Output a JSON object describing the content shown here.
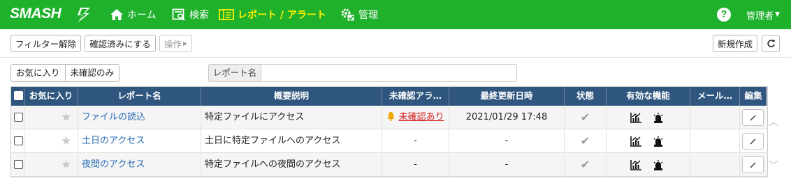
{
  "nav": {
    "logo": "SMASH",
    "items": [
      {
        "label": "ホーム",
        "icon": "home-icon"
      },
      {
        "label": "検索",
        "icon": "search-document-icon"
      },
      {
        "label": "レポート / アラート",
        "icon": "report-icon"
      },
      {
        "label": "管理",
        "icon": "settings-icon"
      }
    ],
    "help": "?",
    "user": "管理者",
    "colors": {
      "bar": "#1fb02c",
      "active": "#fff200"
    }
  },
  "toolbar": {
    "clear_filter": "フィルター解除",
    "mark_confirmed": "確認済みにする",
    "operations": "操作",
    "new": "新規作成"
  },
  "filters": {
    "favorites": "お気に入り",
    "unconfirmed_only": "未確認のみ",
    "search_label": "レポート名",
    "search_value": ""
  },
  "table": {
    "headers": [
      "お気に入り",
      "レポート名",
      "概要説明",
      "未確認アラ…",
      "最終更新日時",
      "状態",
      "有効な機能",
      "メール…",
      "編集"
    ],
    "rows": [
      {
        "name": "ファイルの読込",
        "description": "特定ファイルにアクセス",
        "alert": "未確認あり",
        "updated": "2021/01/29 17:48"
      },
      {
        "name": "土日のアクセス",
        "description": "土日に特定ファイルへのアクセス",
        "alert": "-",
        "updated": "-"
      },
      {
        "name": "夜間のアクセス",
        "description": "特定ファイルへの夜間のアクセス",
        "alert": "-",
        "updated": "-"
      }
    ],
    "header_color": "#2f567e",
    "alert_color": "#d41e1e",
    "link_color": "#2a6db3"
  }
}
